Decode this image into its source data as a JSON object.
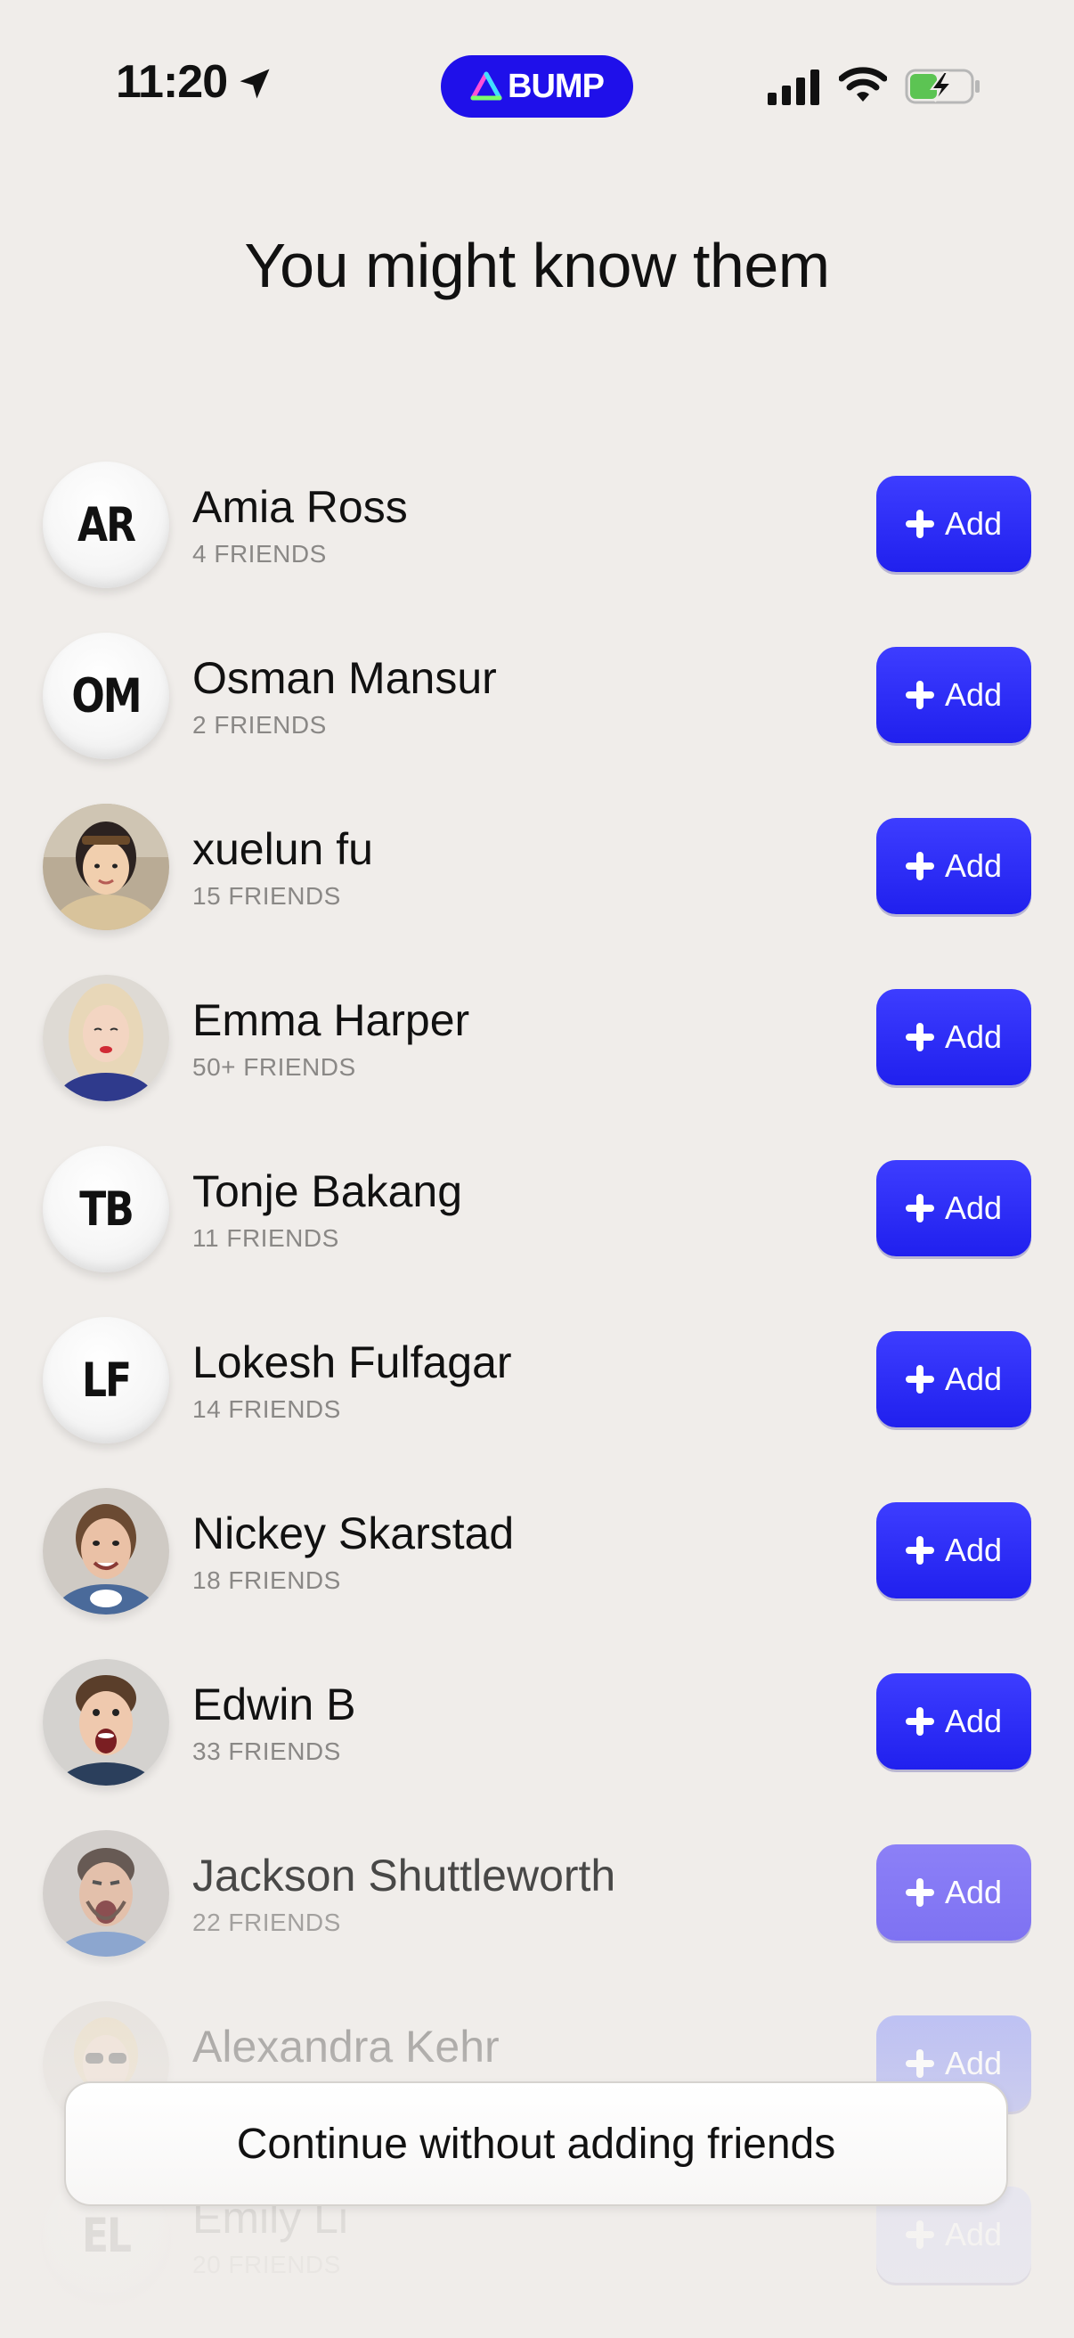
{
  "status_bar": {
    "time": "11:20",
    "brand": "BUMP",
    "location_icon": "location-arrow-icon",
    "signal_icon": "cellular-signal-icon",
    "wifi_icon": "wifi-icon",
    "battery_icon": "battery-charging-icon",
    "battery_level": 0.45
  },
  "title": "You might know them",
  "add_label": "Add",
  "people": [
    {
      "name": "Amia Ross",
      "friends": "4 FRIENDS",
      "initials": "AR",
      "avatar": "initials"
    },
    {
      "name": "Osman Mansur",
      "friends": "2 FRIENDS",
      "initials": "OM",
      "avatar": "initials"
    },
    {
      "name": "xuelun fu",
      "friends": "15 FRIENDS",
      "avatar": "photo"
    },
    {
      "name": "Emma Harper",
      "friends": "50+ FRIENDS",
      "avatar": "photo"
    },
    {
      "name": "Tonje Bakang",
      "friends": "11 FRIENDS",
      "initials": "TB",
      "avatar": "initials"
    },
    {
      "name": "Lokesh Fulfagar",
      "friends": "14 FRIENDS",
      "initials": "LF",
      "avatar": "initials"
    },
    {
      "name": "Nickey Skarstad",
      "friends": "18 FRIENDS",
      "avatar": "photo"
    },
    {
      "name": "Edwin B",
      "friends": "33 FRIENDS",
      "avatar": "photo"
    },
    {
      "name": "Jackson Shuttleworth",
      "friends": "22 FRIENDS",
      "avatar": "photo"
    },
    {
      "name": "Alexandra Kehr",
      "friends": "",
      "avatar": "photo"
    },
    {
      "name": "Emily Li",
      "friends": "20 FRIENDS",
      "initials": "EL",
      "avatar": "initials"
    }
  ],
  "continue_label": "Continue without adding friends",
  "colors": {
    "background": "#f0edea",
    "accent": "#2a22f0",
    "brand_pill": "#1f10ea"
  }
}
